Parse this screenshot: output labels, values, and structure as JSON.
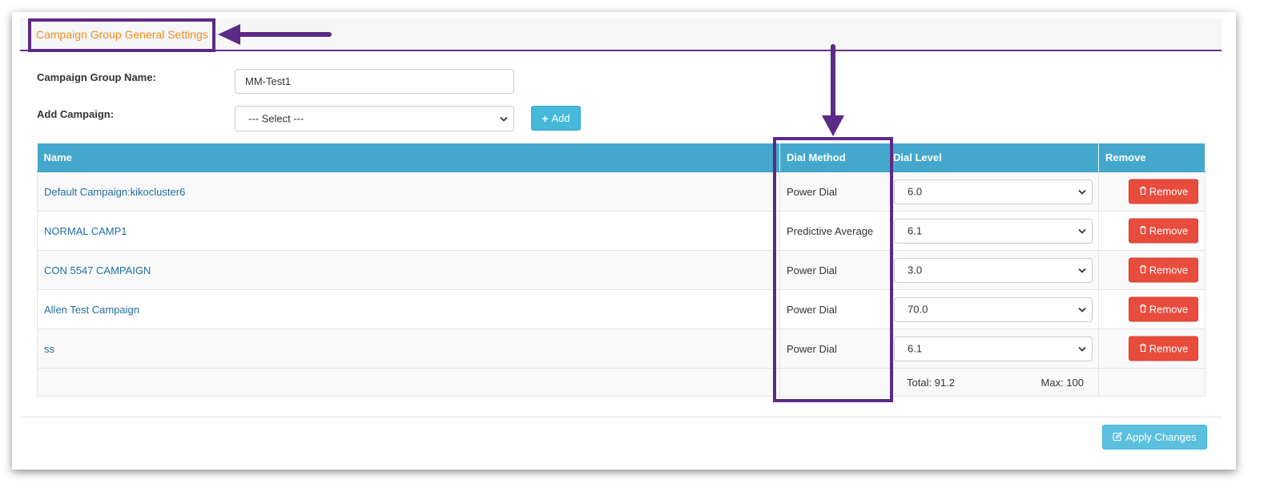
{
  "header": {
    "title": "Campaign Group General Settings"
  },
  "form": {
    "group_name_label": "Campaign Group Name:",
    "group_name_value": "MM-Test1",
    "add_campaign_label": "Add Campaign:",
    "add_campaign_selected": "--- Select ---",
    "add_button_label": "Add"
  },
  "table": {
    "columns": [
      "Name",
      "Dial Method",
      "Dial Level",
      "Remove"
    ],
    "rows": [
      {
        "name": "Default Campaign:kikocluster6",
        "dial_method": "Power Dial",
        "dial_level": "6.0",
        "remove_label": "Remove"
      },
      {
        "name": "NORMAL CAMP1",
        "dial_method": "Predictive Average",
        "dial_level": "6.1",
        "remove_label": "Remove"
      },
      {
        "name": "CON 5547 CAMPAIGN",
        "dial_method": "Power Dial",
        "dial_level": "3.0",
        "remove_label": "Remove"
      },
      {
        "name": "Allen Test Campaign",
        "dial_method": "Power Dial",
        "dial_level": "70.0",
        "remove_label": "Remove"
      },
      {
        "name": "ss",
        "dial_method": "Power Dial",
        "dial_level": "6.1",
        "remove_label": "Remove"
      }
    ],
    "total_label": "Total: 91.2",
    "max_label": "Max: 100"
  },
  "footer": {
    "apply_label": "Apply Changes"
  },
  "colors": {
    "title_orange": "#f28c1c",
    "header_blue": "#44a8cc",
    "remove_red": "#e84c3d",
    "apply_blue": "#5bc0de",
    "annotation_purple": "#5b2a86"
  },
  "icons": {
    "add": "plus-icon",
    "remove": "trash-icon",
    "apply": "edit-icon",
    "select": "chevron-down-icon"
  }
}
